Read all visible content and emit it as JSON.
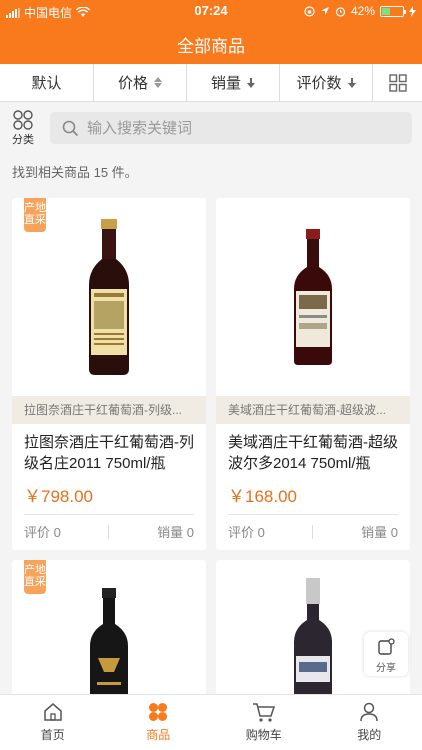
{
  "status": {
    "carrier": "中国电信",
    "time": "07:24",
    "battery": "42%",
    "battery_level": 0.42
  },
  "header": {
    "title": "全部商品"
  },
  "sort": {
    "default": "默认",
    "price": "价格",
    "sales": "销量",
    "rating": "评价数",
    "grid_icon": "grid-icon"
  },
  "category": {
    "label": "分类",
    "icon": "category-icon"
  },
  "search": {
    "placeholder": "输入搜索关键词",
    "value": ""
  },
  "result_count": "找到相关商品 15 件。",
  "products": [
    {
      "tag": "产地直采",
      "strip": "拉图奈酒庄干红葡萄酒-列级...",
      "name": "拉图奈酒庄干红葡萄酒-列级名庄2011 750ml/瓶",
      "price": "￥798.00",
      "rating": "评价 0",
      "sales": "销量 0"
    },
    {
      "tag": "",
      "strip": "美域酒庄干红葡萄酒-超级波...",
      "name": "美域酒庄干红葡萄酒-超级波尔多2014 750ml/瓶",
      "price": "￥168.00",
      "rating": "评价 0",
      "sales": "销量 0"
    },
    {
      "tag": "产地直采",
      "strip": "",
      "name": "",
      "price": "",
      "rating": "",
      "sales": ""
    },
    {
      "tag": "",
      "strip": "",
      "name": "",
      "price": "",
      "rating": "",
      "sales": ""
    }
  ],
  "share": {
    "label": "分享"
  },
  "tabs": [
    {
      "label": "首页",
      "icon": "home-icon"
    },
    {
      "label": "商品",
      "icon": "products-icon",
      "active": true
    },
    {
      "label": "购物车",
      "icon": "cart-icon"
    },
    {
      "label": "我的",
      "icon": "user-icon"
    }
  ],
  "colors": {
    "accent": "#f97a1c",
    "price": "#e8701f",
    "tag": "#f7a35b"
  }
}
